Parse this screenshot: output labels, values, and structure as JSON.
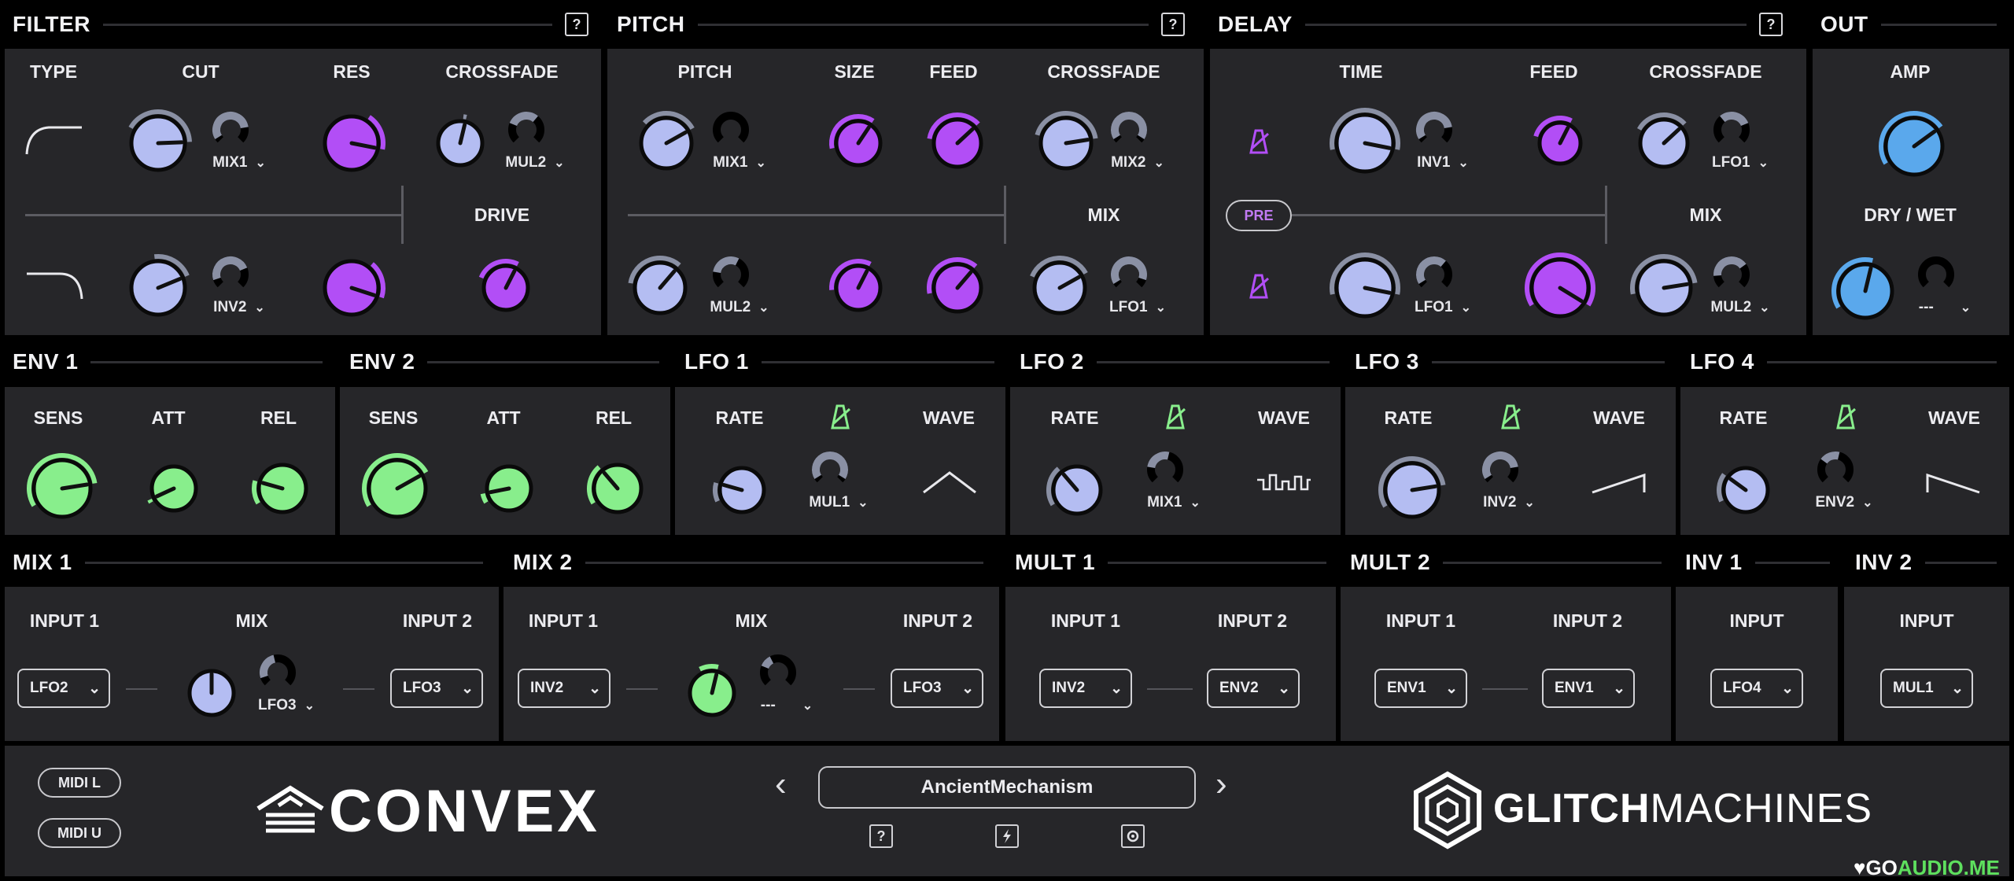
{
  "colors": {
    "knob_blue": "#b4bdf2",
    "knob_purple": "#b24ef6",
    "knob_green": "#88ee8c",
    "knob_cyan": "#5aa8ec",
    "arc_gray": "#8a90a4",
    "panel": "#262629",
    "bg": "#000000"
  },
  "headers": {
    "filter": "FILTER",
    "pitch": "PITCH",
    "delay": "DELAY",
    "out": "OUT",
    "env1": "ENV 1",
    "env2": "ENV 2",
    "lfo1": "LFO 1",
    "lfo2": "LFO 2",
    "lfo3": "LFO 3",
    "lfo4": "LFO 4",
    "mix1": "MIX 1",
    "mix2": "MIX 2",
    "mult1": "MULT 1",
    "mult2": "MULT 2",
    "inv1": "INV 1",
    "inv2": "INV 2"
  },
  "help_label": "?",
  "filter": {
    "type": "TYPE",
    "cut": "CUT",
    "res": "RES",
    "crossfade": "CROSSFADE",
    "drive": "DRIVE",
    "mod_cut_top": "MIX1",
    "mod_cf": "MUL2",
    "mod_cut_bot": "INV2"
  },
  "pitch": {
    "pitch": "PITCH",
    "size": "SIZE",
    "feed": "FEED",
    "crossfade": "CROSSFADE",
    "mix": "MIX",
    "mod_pitch_top": "MIX1",
    "mod_cf": "MIX2",
    "mod_pitch_bot": "MUL2",
    "mod_mix": "LFO1"
  },
  "delay": {
    "time": "TIME",
    "feed": "FEED",
    "crossfade": "CROSSFADE",
    "mix": "MIX",
    "pre": "PRE",
    "mod_time_top": "INV1",
    "mod_cf": "LFO1",
    "mod_time_bot": "LFO1",
    "mod_mix": "MUL2"
  },
  "out": {
    "amp": "AMP",
    "drywet": "DRY / WET",
    "mod_drywet": "---"
  },
  "env1": {
    "sens": "SENS",
    "att": "ATT",
    "rel": "REL"
  },
  "env2": {
    "sens": "SENS",
    "att": "ATT",
    "rel": "REL"
  },
  "lfo1": {
    "rate": "RATE",
    "wave": "WAVE",
    "mod": "MUL1"
  },
  "lfo2": {
    "rate": "RATE",
    "wave": "WAVE",
    "mod": "MIX1"
  },
  "lfo3": {
    "rate": "RATE",
    "wave": "WAVE",
    "mod": "INV2"
  },
  "lfo4": {
    "rate": "RATE",
    "wave": "WAVE",
    "mod": "ENV2"
  },
  "mix1": {
    "input1": "INPUT 1",
    "mix": "MIX",
    "input2": "INPUT 2",
    "in1_value": "LFO2",
    "in2_value": "LFO3",
    "mod": "LFO3"
  },
  "mix2": {
    "input1": "INPUT 1",
    "mix": "MIX",
    "input2": "INPUT 2",
    "in1_value": "INV2",
    "in2_value": "LFO3",
    "mod": "---"
  },
  "mult1": {
    "input1": "INPUT 1",
    "input2": "INPUT 2",
    "in1_value": "INV2",
    "in2_value": "ENV2"
  },
  "mult2": {
    "input1": "INPUT 1",
    "input2": "INPUT 2",
    "in1_value": "ENV1",
    "in2_value": "ENV1"
  },
  "inv1": {
    "input": "INPUT",
    "in_value": "LFO4"
  },
  "inv2": {
    "input": "INPUT",
    "in_value": "MUL1"
  },
  "footer": {
    "midi_l": "MIDI L",
    "midi_u": "MIDI U",
    "preset": "AncientMechanism",
    "brand": "CONVEX",
    "company_bold": "GLITCH",
    "company_rest": "MACHINES",
    "watermark_a": "♥GO",
    "watermark_b": "AUDIO.ME"
  }
}
